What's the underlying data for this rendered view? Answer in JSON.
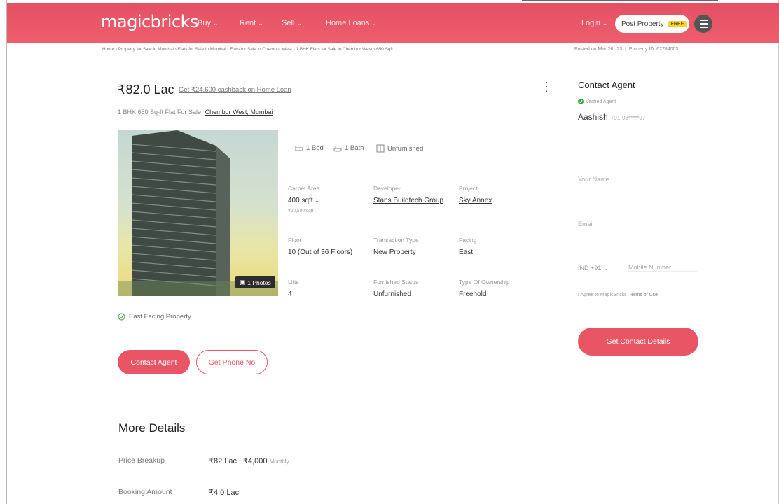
{
  "header": {
    "logo": "magicbricks",
    "nav": [
      {
        "label": "Buy"
      },
      {
        "label": "Rent"
      },
      {
        "label": "Sell"
      },
      {
        "label": "Home Loans"
      }
    ],
    "login": "Login",
    "post_property": "Post Property",
    "free_badge": "FREE"
  },
  "breadcrumb": "Home › Property for Sale in Mumbai › Flats for Sale in Mumbai › Flats for Sale in Chembur West › 1 BHK Flats for Sale in Chembur West › 650 Sqft",
  "posted": "Posted on Mar 26, '23",
  "property_id": "Property ID: 62784003",
  "listing": {
    "price": "₹82.0 Lac",
    "cashback": "Get ₹24,600 cashback on Home Loan",
    "subtitle": "1 BHK 650 Sq-ft Flat For Sale",
    "location": "Chembur West, Mumbai",
    "photos_badge": "1 Photos",
    "amenities": {
      "bed": "1 Bed",
      "bath": "1 Bath",
      "furnish": "Unfurnished"
    },
    "specs": {
      "carpet_area": {
        "label": "Carpet Area",
        "value": "400 sqft",
        "sub": "₹20,500/sqft"
      },
      "developer": {
        "label": "Developer",
        "value": "Stans Buildtech Group"
      },
      "project": {
        "label": "Project",
        "value": "Sky Annex"
      },
      "floor": {
        "label": "Floor",
        "value": "10 (Out of 36 Floors)"
      },
      "transaction": {
        "label": "Transaction Type",
        "value": "New Property"
      },
      "facing": {
        "label": "Facing",
        "value": "East"
      },
      "lifts": {
        "label": "Lifts",
        "value": "4"
      },
      "furnished": {
        "label": "Furnished Status",
        "value": "Unfurnished"
      },
      "ownership": {
        "label": "Type Of Ownership",
        "value": "Freehold"
      }
    },
    "facing_note": "East Facing Property",
    "buttons": {
      "contact": "Contact Agent",
      "phone": "Get Phone No"
    }
  },
  "more_details": {
    "title": "More Details",
    "rows": [
      {
        "label": "Price Breakup",
        "value": "₹82 Lac | ₹4,000",
        "suffix": "Monthly"
      },
      {
        "label": "Booking Amount",
        "value": "₹4.0 Lac"
      }
    ]
  },
  "contact_panel": {
    "title": "Contact Agent",
    "verified": "Verified Agent",
    "agent_name": "Aashish",
    "agent_phone": "+91-98*****07",
    "name_placeholder": "Your Name",
    "email_placeholder": "Email",
    "country_code": "IND +91",
    "mobile_placeholder": "Mobile Number",
    "terms_text": "I Agree to MagicBricks",
    "terms_link": "Terms of Use",
    "cta": "Get Contact Details"
  },
  "colors": {
    "brand": "#e95564",
    "header": "#ee5e6d",
    "free_badge": "#f6d230"
  }
}
